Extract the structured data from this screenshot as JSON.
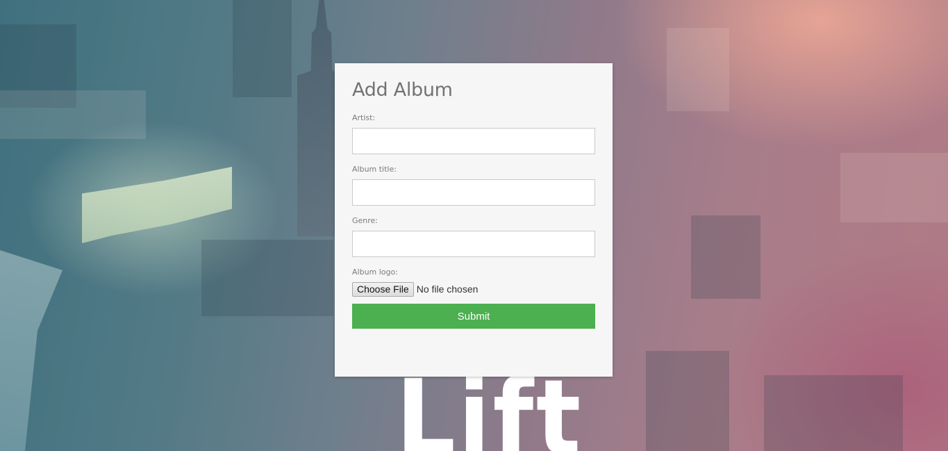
{
  "form": {
    "title": "Add Album",
    "artist_label": "Artist:",
    "artist_value": "",
    "album_title_label": "Album title:",
    "album_title_value": "",
    "genre_label": "Genre:",
    "genre_value": "",
    "logo_label": "Album logo:",
    "choose_file_label": "Choose File",
    "file_status": "No file chosen",
    "submit_label": "Submit"
  },
  "background": {
    "overlay_text": "Lift"
  },
  "colors": {
    "submit_bg": "#4caf50",
    "card_bg": "#f6f6f6",
    "title_text": "#737373"
  }
}
